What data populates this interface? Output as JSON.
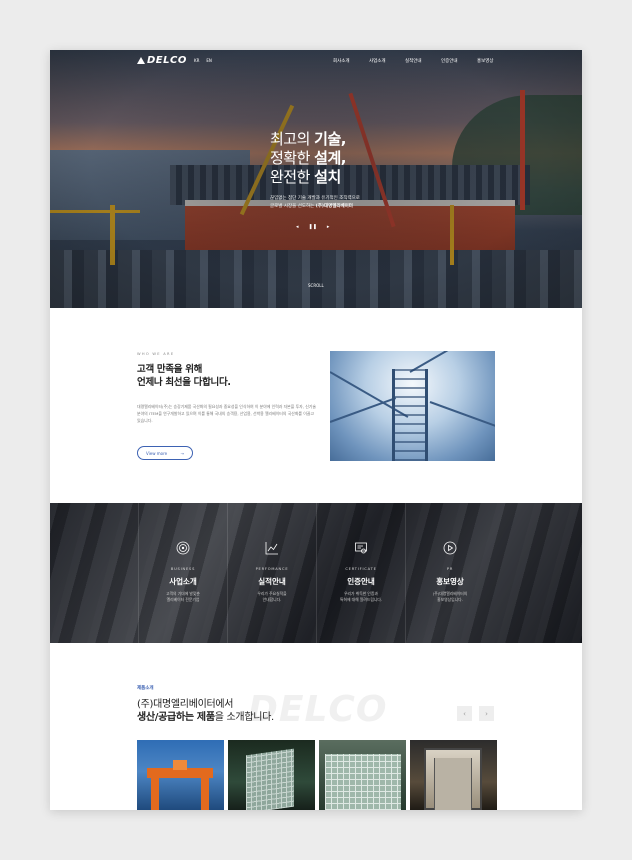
{
  "header": {
    "logo": "DELCO",
    "languages": [
      "KR",
      "EN"
    ],
    "menu": [
      "회사소개",
      "사업소개",
      "실적안내",
      "인증안내",
      "홍보영상"
    ]
  },
  "hero": {
    "line1_a": "최고의 ",
    "line1_b": "기술,",
    "line2_a": "정확한 ",
    "line2_b": "설계,",
    "line3_a": "완전한 ",
    "line3_b": "설치",
    "sub1": "끊임없는 첨단 기술 개발과 유기적인 조직력으로",
    "sub2_a": "글로벌 시장을 선도하는 ",
    "sub2_b": "(주)대명엘리베이터",
    "prev": "◂",
    "pause": "❚❚",
    "next": "▸",
    "scroll": "SCROLL"
  },
  "about": {
    "eyebrow": "WHO WE ARE",
    "title1": "고객 만족을 위해",
    "title2": "언제나 최선을 다합니다.",
    "body": "대명엘리베이터(주)는 승강기제품 국산화의 필요성과 중요성을 인식하여 이 분야에 인력과 자본을 투자, 신기술 분야의 ITEM을 연구개발하고 있으며 이를 통해 국내의 승객용, 산업용, 선박용 엘리베이터의 국산화를 이끌고 있습니다.",
    "button": "View more",
    "button_arrow": "→"
  },
  "services": [
    {
      "en": "BUSINESS",
      "ko": "사업소개",
      "desc1": "고객의 기대에 발맞춘",
      "desc2": "엘리베이터 전문기업"
    },
    {
      "en": "PERFOMANCE",
      "ko": "실적안내",
      "desc1": "우리가 주요실적을",
      "desc2": "안내합니다."
    },
    {
      "en": "CERTIFICATE",
      "ko": "인증안내",
      "desc1": "우리가 취득한 인증과",
      "desc2": "특허에 대해 알려드립니다."
    },
    {
      "en": "PR",
      "ko": "홍보영상",
      "desc1": "(주)대명엘리베이터의",
      "desc2": "홍보영상입니다."
    }
  ],
  "products": {
    "tag": "제품소개",
    "ghost": "DELCO",
    "line1": "(주)대명엘리베이터에서",
    "line2_a": "생산/공급하는 제품",
    "line2_b": "을 소개합니다.",
    "prev": "‹",
    "next": "›"
  }
}
